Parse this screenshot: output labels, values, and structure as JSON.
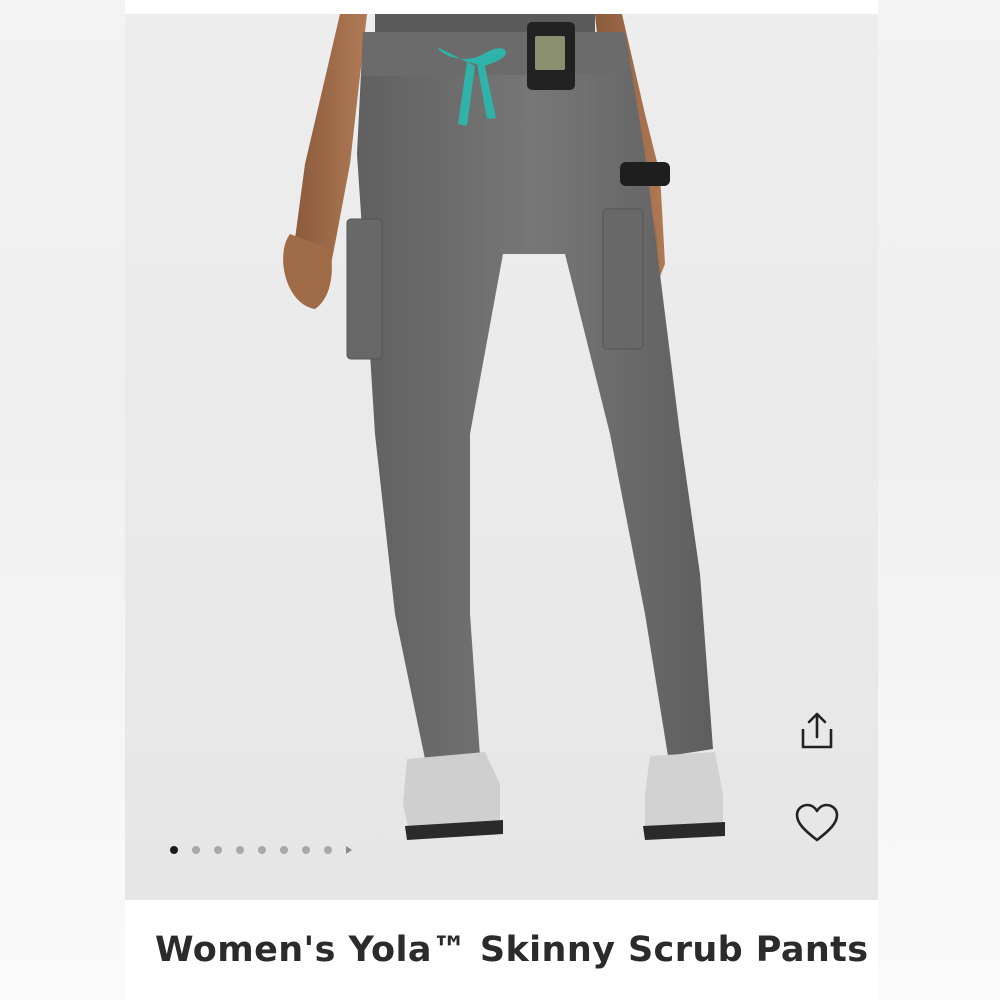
{
  "product": {
    "title": "Women's Yola™ Skinny Scrub Pants",
    "image_alt_subject": "grey scrub pants with teal drawstring"
  },
  "gallery": {
    "total_images": 8,
    "current_index": 1,
    "has_next_arrow": true
  },
  "actions": {
    "share_icon": "share-icon",
    "favorite_icon": "heart-icon"
  },
  "colors": {
    "pants": "#6f6f6f",
    "drawstring": "#2fb3a8",
    "background": "#ebebeb",
    "title_text": "#2b2b2b"
  }
}
